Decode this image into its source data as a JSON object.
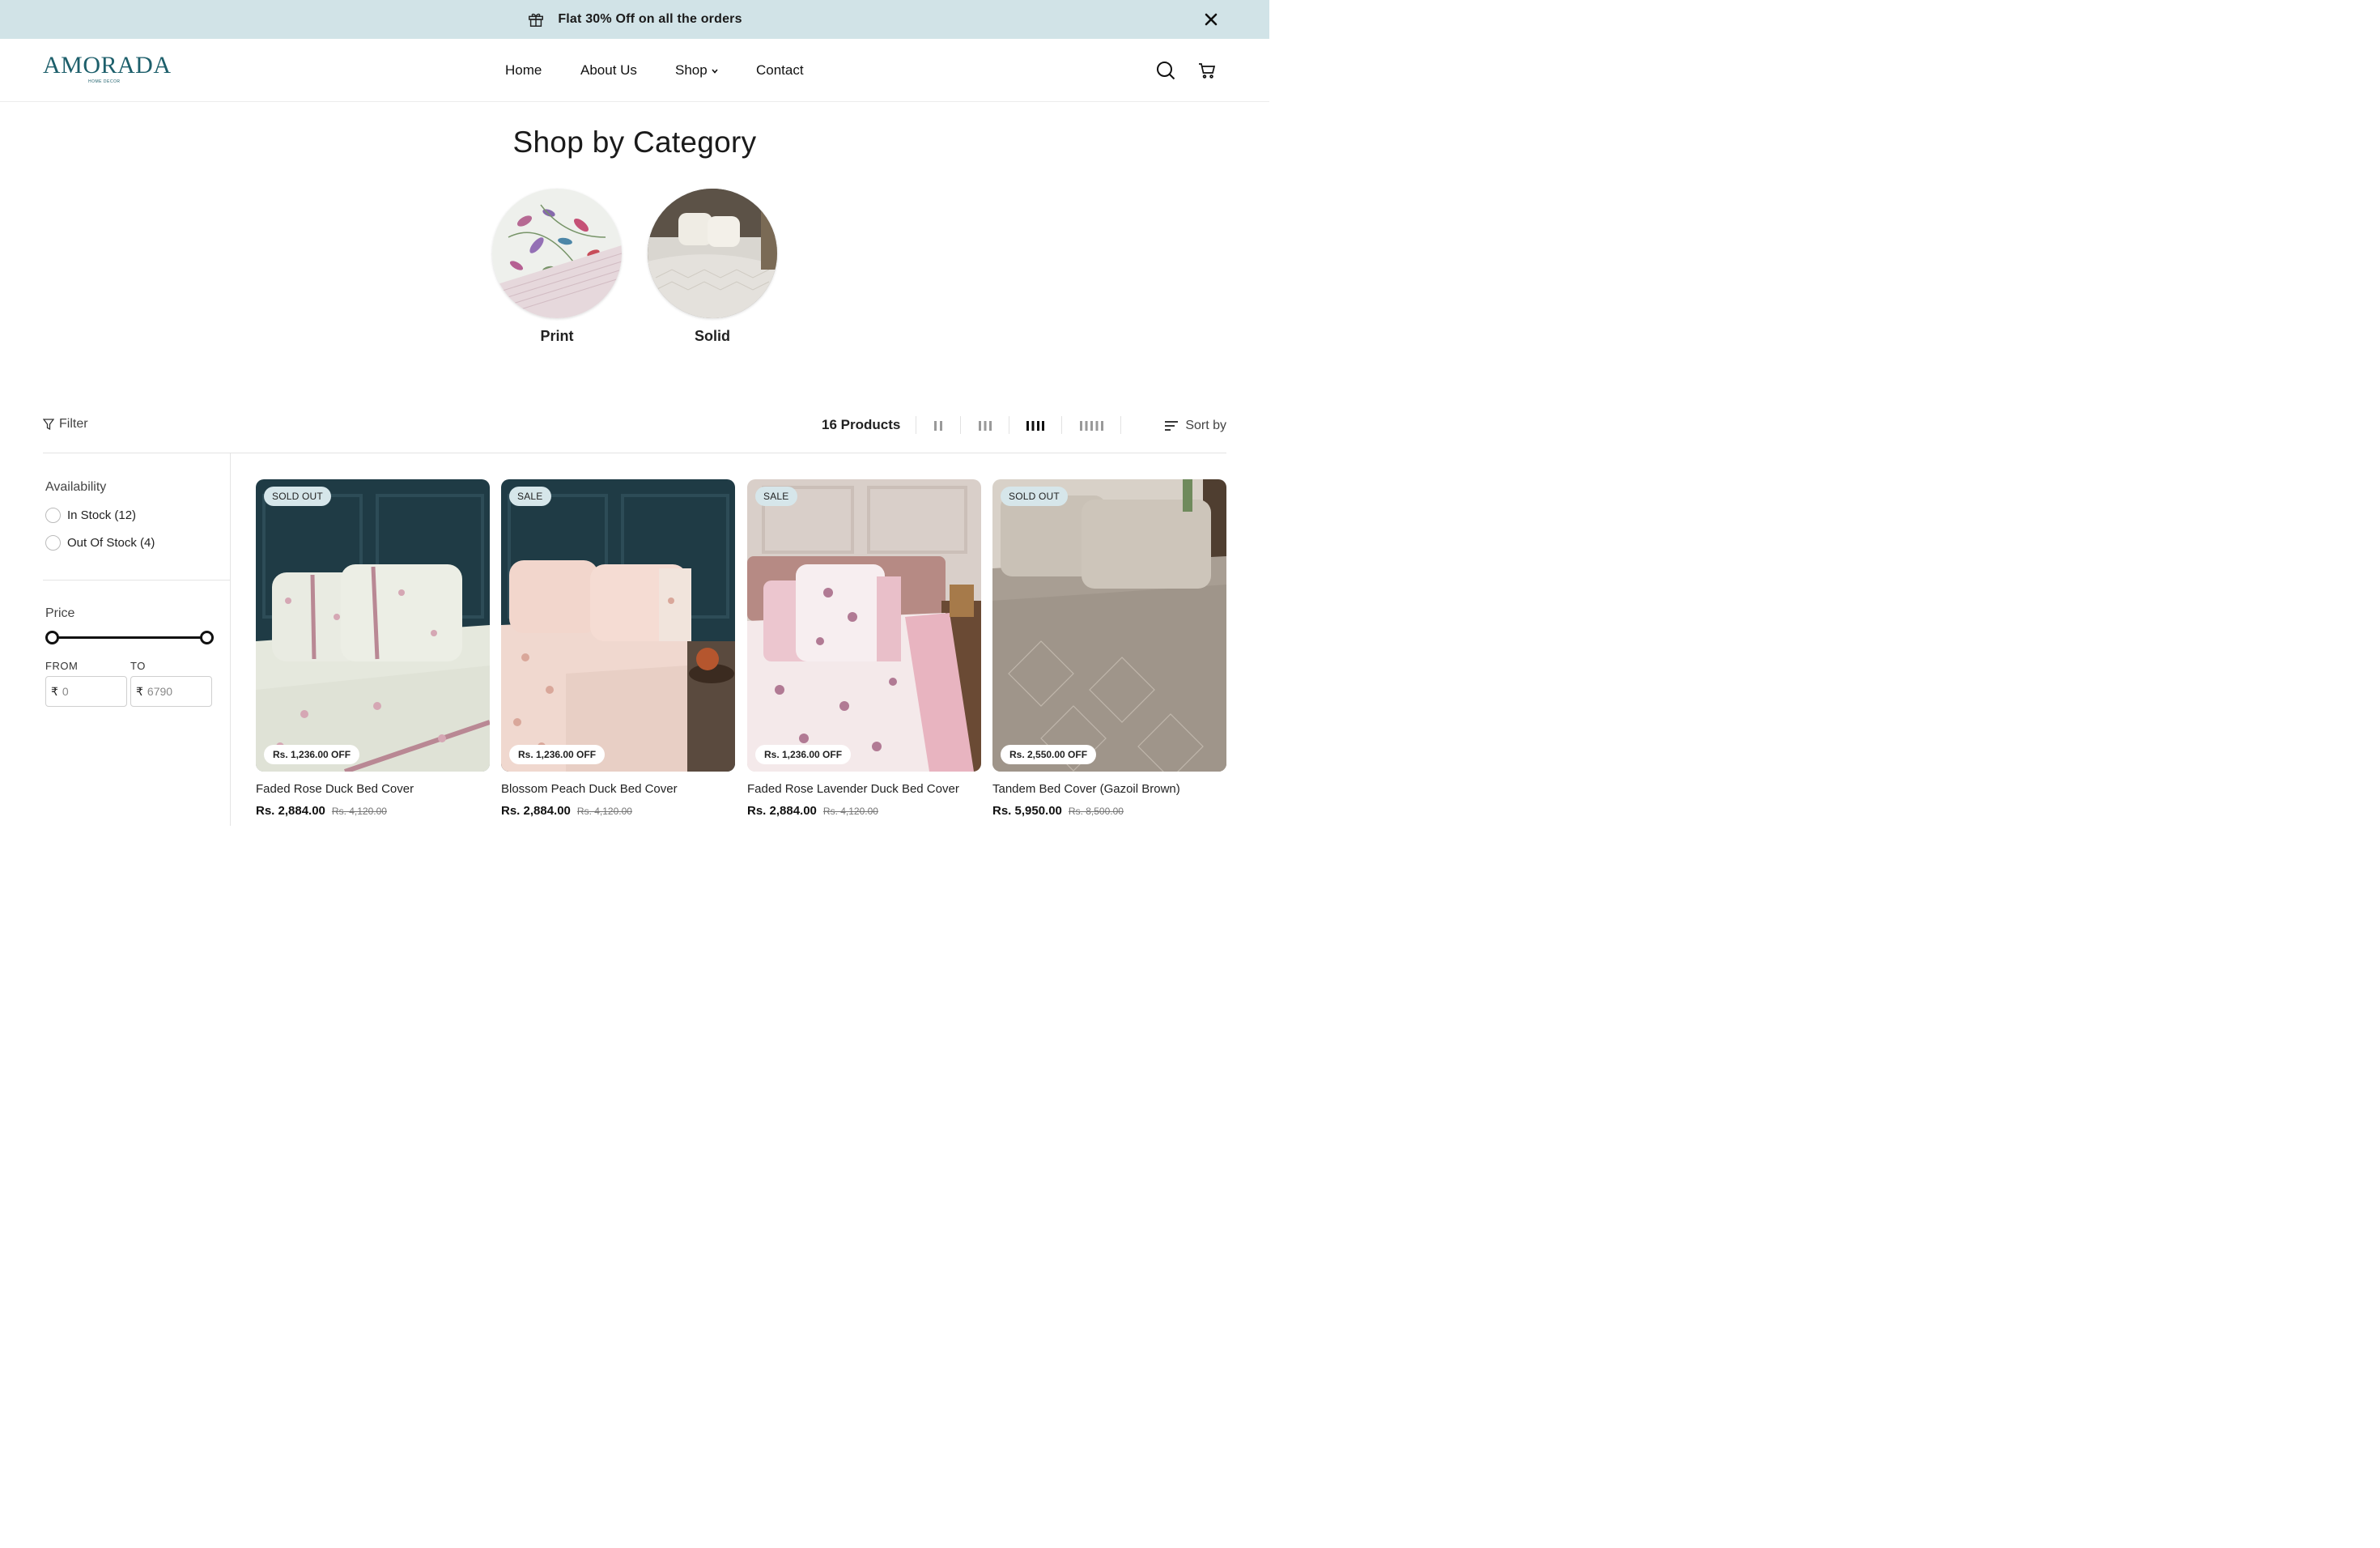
{
  "announcement": {
    "text": "Flat 30% Off on all the orders",
    "icon": "gift-icon",
    "close_icon": "close-icon"
  },
  "header": {
    "logo_text": "AMORADA",
    "logo_sub": "HOME DECOR",
    "nav": {
      "home": "Home",
      "about": "About Us",
      "shop": "Shop",
      "contact": "Contact"
    },
    "icons": [
      "search-icon",
      "cart-icon"
    ]
  },
  "categories": {
    "title": "Shop by Category",
    "items": [
      {
        "label": "Print"
      },
      {
        "label": "Solid"
      }
    ]
  },
  "toolbar": {
    "filter_label": "Filter",
    "product_count": "16 Products",
    "grid_options": [
      "2",
      "3",
      "4",
      "5"
    ],
    "selected_grid": "4",
    "sort_label": "Sort by"
  },
  "sidebar": {
    "availability": {
      "heading": "Availability",
      "options": [
        {
          "label": "In Stock (12)"
        },
        {
          "label": "Out Of Stock (4)"
        }
      ]
    },
    "price": {
      "heading": "Price",
      "from_label": "FROM",
      "to_label": "TO",
      "currency": "₹",
      "from_value": "0",
      "to_value": "6790"
    }
  },
  "products": [
    {
      "badge": "SOLD OUT",
      "off": "Rs. 1,236.00 OFF",
      "name": "Faded Rose Duck Bed Cover",
      "price": "Rs. 2,884.00",
      "compare": "Rs. 4,120.00"
    },
    {
      "badge": "SALE",
      "off": "Rs. 1,236.00 OFF",
      "name": "Blossom Peach Duck Bed Cover",
      "price": "Rs. 2,884.00",
      "compare": "Rs. 4,120.00"
    },
    {
      "badge": "SALE",
      "off": "Rs. 1,236.00 OFF",
      "name": "Faded Rose Lavender Duck Bed Cover",
      "price": "Rs. 2,884.00",
      "compare": "Rs. 4,120.00"
    },
    {
      "badge": "SOLD OUT",
      "off": "Rs. 2,550.00 OFF",
      "name": "Tandem Bed Cover (Gazoil Brown)",
      "price": "Rs. 5,950.00",
      "compare": "Rs. 8,500.00"
    }
  ],
  "colors": {
    "announcement_bg": "#d1e3e7",
    "brand": "#1d5f6b",
    "badge_bg": "#d6e6ea"
  }
}
